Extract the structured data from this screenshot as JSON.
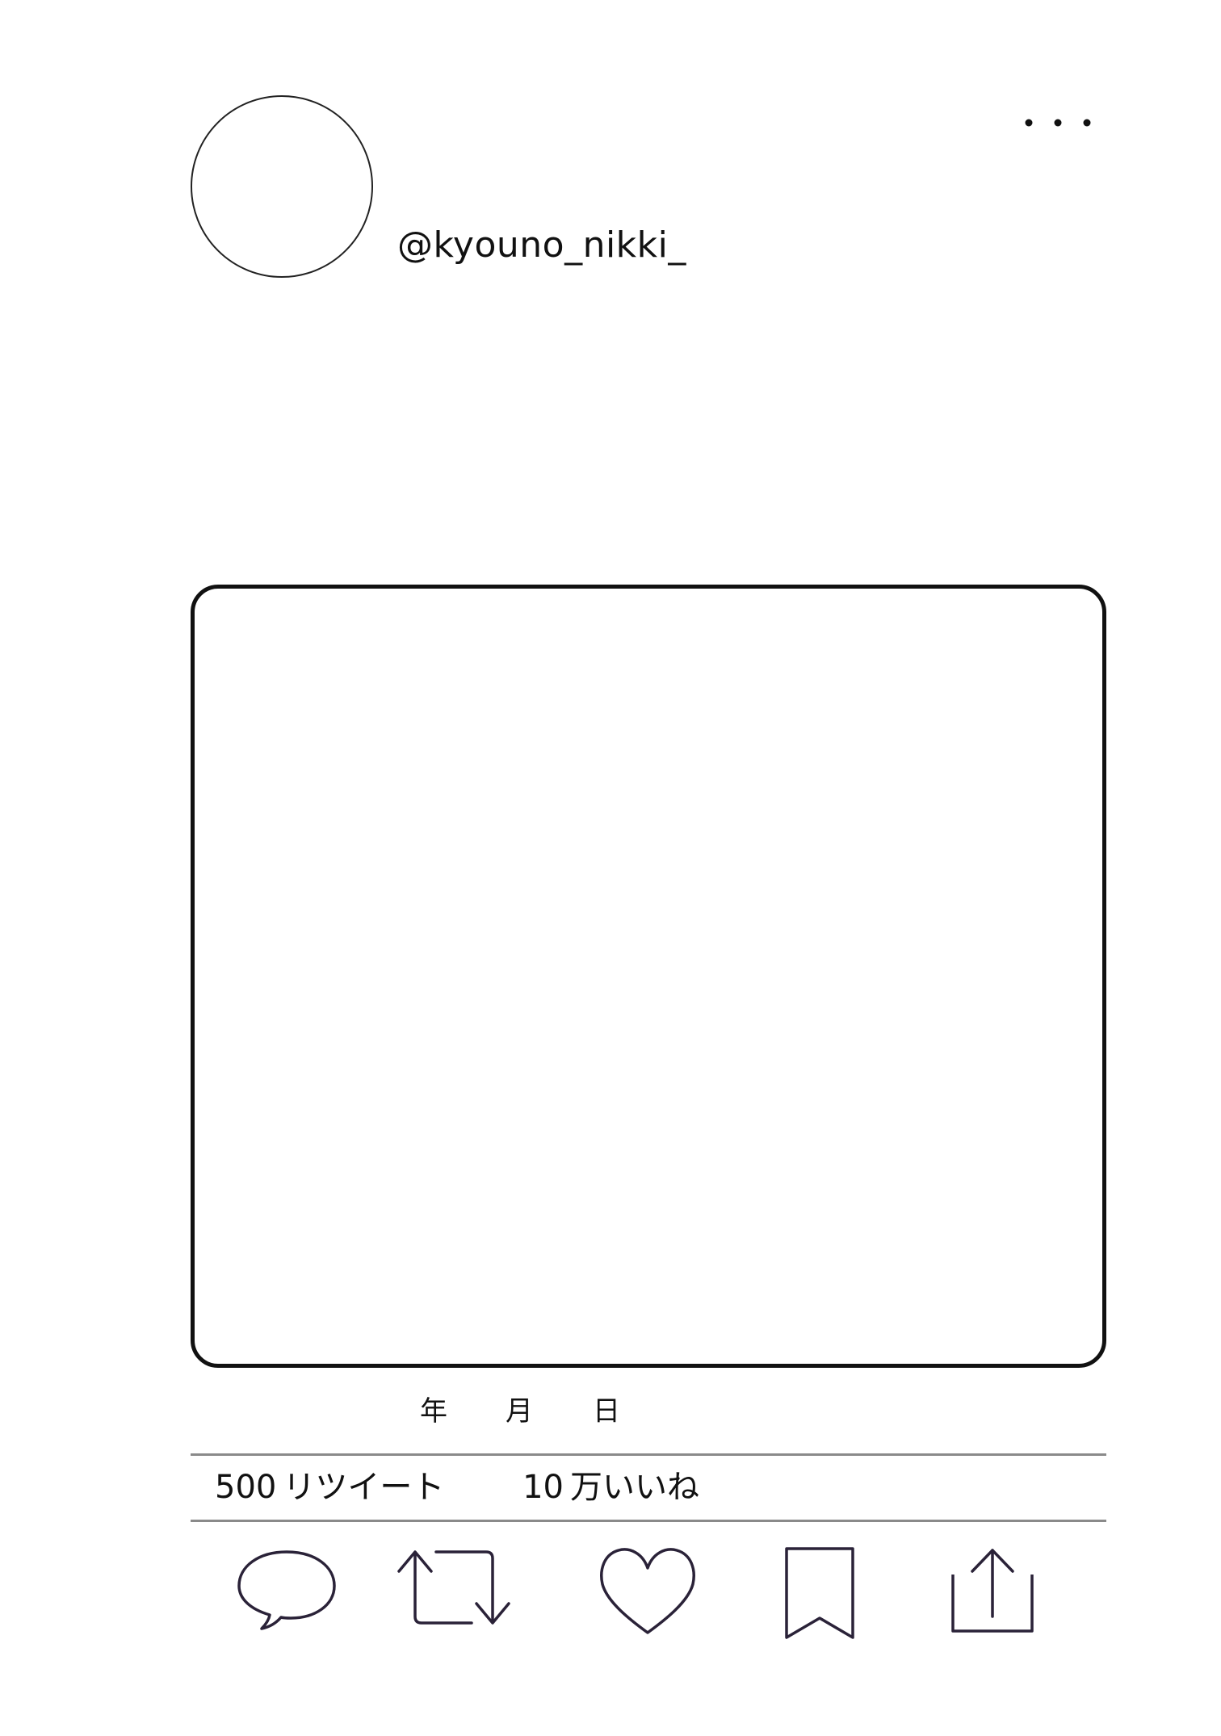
{
  "profile": {
    "handle": "@kyouno_nikki_"
  },
  "menu": {
    "icon": "more-dots-icon"
  },
  "post": {
    "date": {
      "year_label": "年",
      "month_label": "月",
      "day_label": "日"
    },
    "stats": {
      "retweet_count": "500",
      "retweet_label": "リツイート",
      "like_count": "10",
      "like_label": "万いいね"
    }
  },
  "actions": [
    {
      "name": "reply",
      "icon": "speech-bubble-icon"
    },
    {
      "name": "retweet",
      "icon": "retweet-icon"
    },
    {
      "name": "like",
      "icon": "heart-icon"
    },
    {
      "name": "bookmark",
      "icon": "bookmark-icon"
    },
    {
      "name": "share",
      "icon": "share-icon"
    }
  ],
  "colors": {
    "icon_stroke": "#2a2238",
    "divider": "#8a8a8a",
    "text": "#111111"
  }
}
